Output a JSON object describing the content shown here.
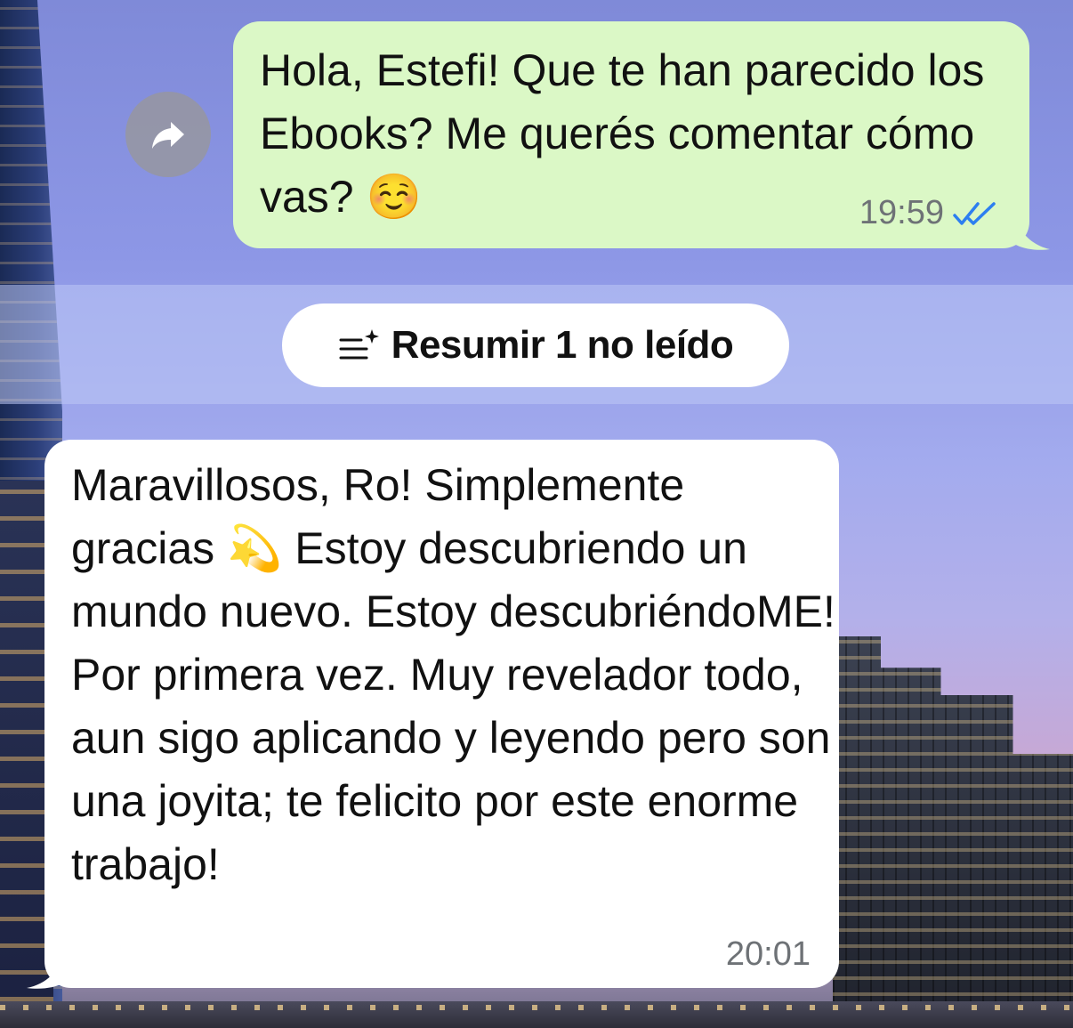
{
  "messages": [
    {
      "direction": "outgoing",
      "text": "Hola, Estefi! Que te han parecido los Ebooks? Me querés comentar cómo vas? ☺️",
      "time": "19:59",
      "status": "read",
      "status_icon": "double-check-icon",
      "bubble_color": "#dbf8c6",
      "tick_color": "#2d7ff0"
    },
    {
      "direction": "incoming",
      "text": "Maravillosos, Ro! Simplemente gracias 💫 Estoy descubriendo un mundo nuevo. Estoy descubriéndoME! Por primera vez. Muy revelador todo, aun sigo aplicando y leyendo pero son una joyita; te felicito por este enorme trabajo!",
      "time": "20:01",
      "bubble_color": "#ffffff"
    }
  ],
  "forward_button": {
    "icon": "forward-arrow-icon"
  },
  "unread_summary": {
    "label": "Resumir 1 no leído",
    "icon": "summarize-sparkle-icon"
  }
}
